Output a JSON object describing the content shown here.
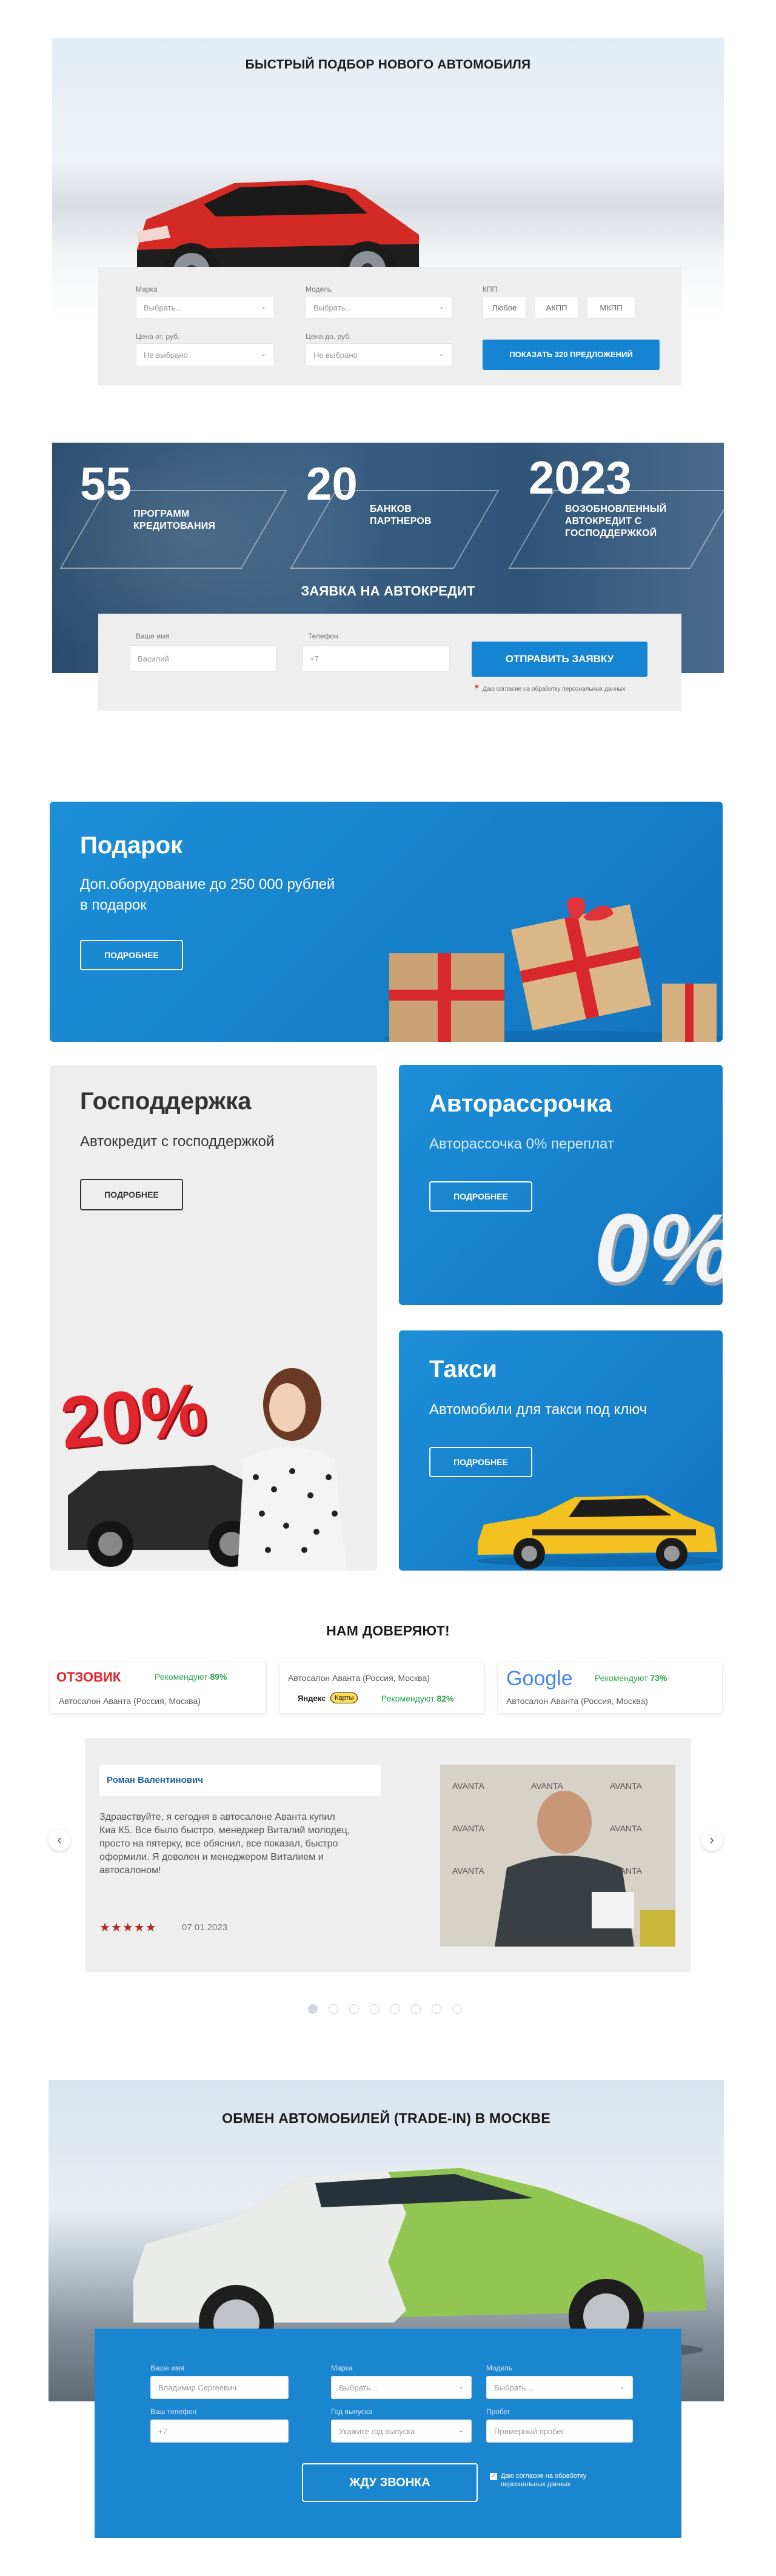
{
  "selection": {
    "title": "БЫСТРЫЙ ПОДБОР НОВОГО АВТОМОБИЛЯ",
    "brand_label": "Марка",
    "brand_placeholder": "Выбрать...",
    "model_label": "Модель",
    "model_placeholder": "Выбрать...",
    "kpp_label": "КПП",
    "kpp_options": [
      "Любое",
      "АКПП",
      "МКПП"
    ],
    "price_from_label": "Цена от, руб.",
    "price_from_placeholder": "Не выбрано",
    "price_to_label": "Цена до, руб.",
    "price_to_placeholder": "Не выбрано",
    "show_button": "ПОКАЗАТЬ 320 ПРЕДЛОЖЕНИЙ"
  },
  "credit": {
    "stats": [
      {
        "number": "55",
        "label1": "ПРОГРАММ",
        "label2": "КРЕДИТОВАНИЯ"
      },
      {
        "number": "20",
        "label1": "БАНКОВ",
        "label2": "ПАРТНЕРОВ"
      },
      {
        "number": "2023",
        "label1": "ВОЗОБНОВЛЕННЫЙ",
        "label2": "АВТОКРЕДИТ С",
        "label3": "ГОСПОДДЕРЖКОЙ"
      }
    ],
    "form_title": "ЗАЯВКА НА АВТОКРЕДИТ",
    "name_label": "Ваше имя",
    "name_placeholder": "Василий",
    "phone_label": "Телефон",
    "phone_placeholder": "+7",
    "submit": "ОТПРАВИТЬ ЗАЯВКУ",
    "consent": "Даю согласие на обработку персональных данных"
  },
  "promos": {
    "gift": {
      "title": "Подарок",
      "text1": "Доп.оборудование до 250 000 рублей",
      "text2": "в подарок",
      "button": "ПОДРОБНЕЕ"
    },
    "support": {
      "title": "Господдержка",
      "text": "Автокредит с господдержкой",
      "button": "ПОДРОБНЕЕ",
      "badge": "20%"
    },
    "installment": {
      "title": "Авторассрочка",
      "text": "Авторассочка 0% переплат",
      "button": "ПОДРОБНЕЕ",
      "badge": "0%"
    },
    "taxi": {
      "title": "Такси",
      "text": "Автомобили для такси под ключ",
      "button": "ПОДРОБНЕЕ"
    }
  },
  "trust": {
    "title": "НАМ ДОВЕРЯЮТ!",
    "sources": [
      {
        "logo": "ОТЗОВИК",
        "recommend_text": "Рекомендуют",
        "percent": "89%",
        "dealer": "Автосалон Аванта (Россия, Москва)"
      },
      {
        "logo_main": "Яндекс",
        "logo_badge": "Карты",
        "recommend_text": "Рекомендуют",
        "percent": "82%",
        "dealer": "Автосалон Аванта (Россия, Москва)"
      },
      {
        "logo": "Google",
        "recommend_text": "Рекомендуют",
        "percent": "73%",
        "dealer": "Автосалон Аванта (Россия, Москва)"
      }
    ],
    "review": {
      "author": "Роман Валентинович",
      "text": [
        "Здравствуйте, я сегодня в автосалоне Аванта купил",
        "Киа К5. Все было быстро, менеджер Виталий молодец,",
        "просто на пятерку, все обяснил, все показал, быстро",
        "оформили. Я доволен и менеджером Виталием и",
        "автосалоном!"
      ],
      "stars": "★★★★★",
      "rating": 4.5,
      "date": "07.01.2023"
    },
    "dots_count": 8,
    "active_dot": 1
  },
  "tradein": {
    "title": "ОБМЕН АВТОМОБИЛЕЙ (TRADE-IN) В МОСКВЕ",
    "name_label": "Ваше имя",
    "name_placeholder": "Владимир Сергеевич",
    "phone_label": "Ваш телефон",
    "phone_placeholder": "+7",
    "brand_label": "Марка",
    "brand_placeholder": "Выбрать...",
    "year_label": "Год выпуска",
    "year_placeholder": "Укажите год выпуска",
    "model_label": "Модель",
    "model_placeholder": "Выбрать...",
    "mileage_label": "Пробег",
    "mileage_placeholder": "Примерный пробег",
    "call_button": "ЖДУ ЗВОНКА",
    "consent1": "Даю согласие на обработку",
    "consent2": "персональных данных"
  },
  "colors": {
    "accent": "#1684d2",
    "green": "#2aa34a",
    "red": "#e0232b"
  }
}
